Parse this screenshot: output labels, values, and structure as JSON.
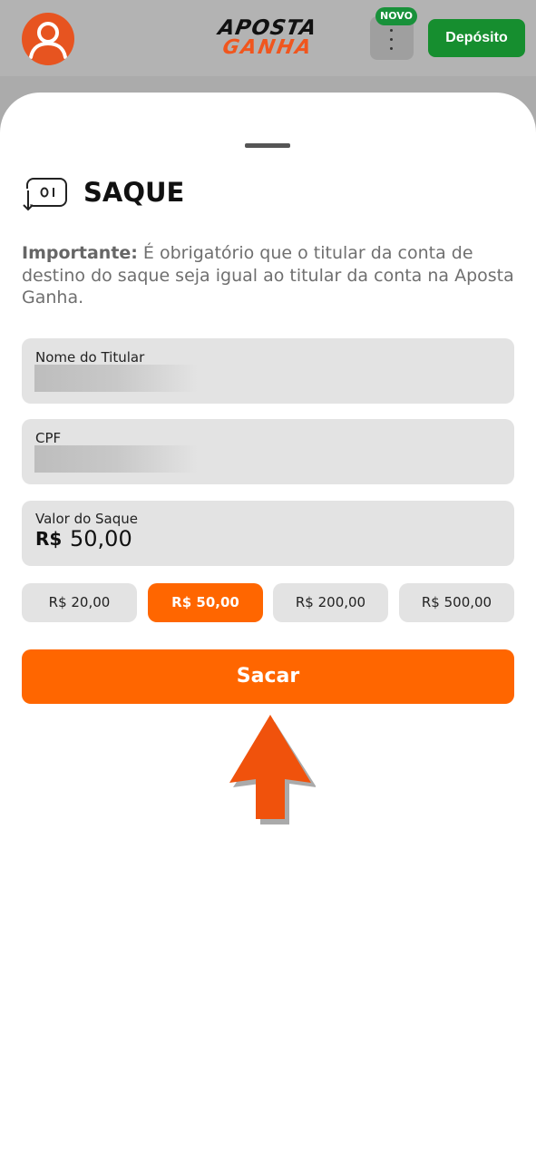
{
  "header": {
    "logo_top": "APOSTA",
    "logo_bottom": "GANHA",
    "badge": "NOVO",
    "deposit_label": "Depósito"
  },
  "sheet": {
    "title": "SAQUE",
    "notice_bold": "Importante:",
    "notice_text": " É obrigatório que o titular da conta de destino do saque seja igual ao titular da conta na Aposta Ganha.",
    "fields": {
      "holder_label": "Nome do Titular",
      "cpf_label": "CPF",
      "amount_label": "Valor do Saque",
      "currency": "R$",
      "amount": "50,00"
    },
    "chips": [
      "R$ 20,00",
      "R$ 50,00",
      "R$ 200,00",
      "R$ 500,00"
    ],
    "selected_chip_index": 1,
    "submit_label": "Sacar"
  },
  "colors": {
    "brand_orange": "#ff6600",
    "deposit_green": "#168e2f",
    "badge_green": "#18913a",
    "avatar_orange": "#e75420"
  },
  "icons": [
    "user-avatar-icon",
    "more-vertical-icon",
    "withdraw-icon",
    "arrow-up-icon"
  ]
}
